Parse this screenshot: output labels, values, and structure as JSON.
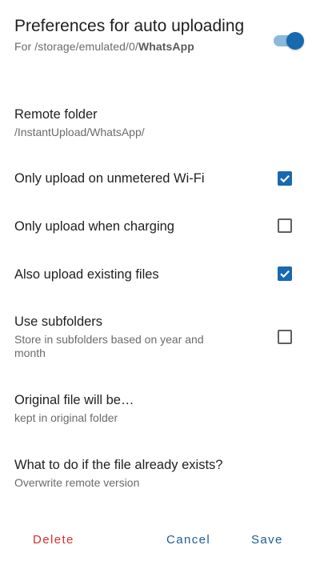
{
  "header": {
    "title": "Preferences for auto uploading",
    "subtitle_prefix": "For /storage/emulated/0/",
    "subtitle_bold": "WhatsApp",
    "enabled": true
  },
  "remote_folder": {
    "label": "Remote folder",
    "value": "/InstantUpload/WhatsApp/"
  },
  "options": {
    "wifi": {
      "label": "Only upload on unmetered Wi-Fi",
      "checked": true
    },
    "charging": {
      "label": "Only upload when charging",
      "checked": false
    },
    "existing": {
      "label": "Also upload existing files",
      "checked": true
    },
    "subfolders": {
      "label": "Use subfolders",
      "description": "Store in subfolders based on year and month",
      "checked": false
    }
  },
  "original_file": {
    "label": "Original file will be…",
    "value": "kept in original folder"
  },
  "file_exists": {
    "label": "What to do if the file already exists?",
    "value": "Overwrite remote version"
  },
  "actions": {
    "delete": "Delete",
    "cancel": "Cancel",
    "save": "Save"
  },
  "colors": {
    "accent": "#1769b0",
    "danger": "#d32f2f"
  }
}
